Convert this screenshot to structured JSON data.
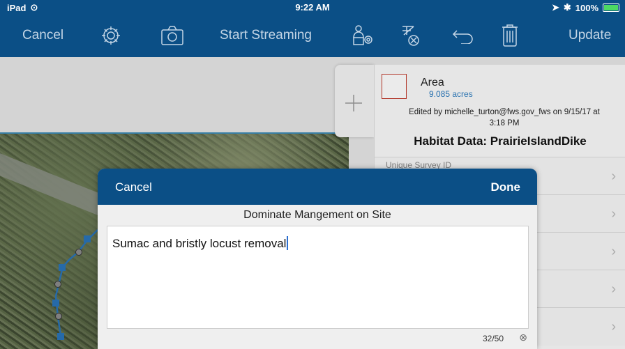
{
  "status_bar": {
    "device": "iPad",
    "time": "9:22 AM",
    "battery": "100%"
  },
  "toolbar": {
    "cancel": "Cancel",
    "start_streaming": "Start Streaming",
    "update": "Update",
    "icons": [
      "gear-icon",
      "camera-icon",
      "person-location-icon",
      "disable-location-icon",
      "undo-icon",
      "trash-icon"
    ]
  },
  "feature": {
    "type": "Area",
    "measurement": "9.085 acres",
    "edited_line1": "Edited by michelle_turton@fws.gov_fws on 9/15/17 at",
    "edited_line2": "3:18 PM",
    "form_title": "Habitat Data: PrairieIslandDike",
    "first_field_label": "Unique Survey ID"
  },
  "modal": {
    "cancel": "Cancel",
    "done": "Done",
    "field_title": "Dominate Mangement on Site",
    "value": "Sumac and bristly locust removal",
    "count": "32/50"
  },
  "colors": {
    "brand_blue": "#0b4f86",
    "toolbar_text": "#c5d6e6",
    "link_blue": "#2f7dbf",
    "area_outline": "#c0392b"
  }
}
